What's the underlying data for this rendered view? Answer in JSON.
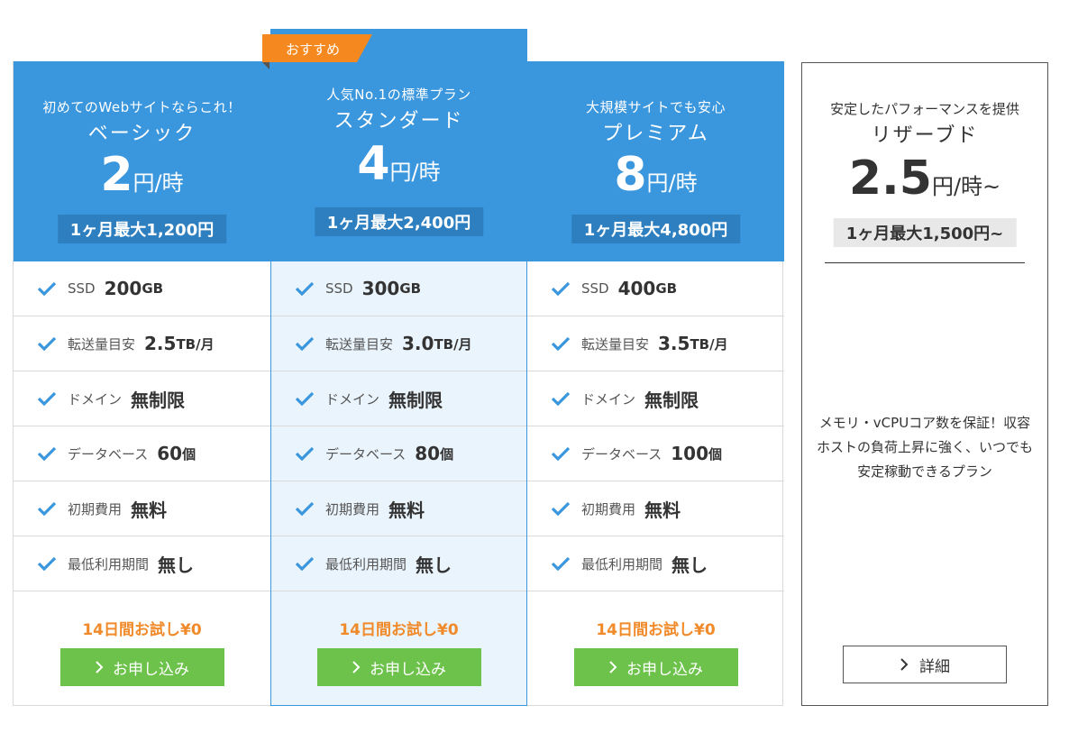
{
  "badge": {
    "label": "おすすめ"
  },
  "colors": {
    "brand_blue": "#3a96dd",
    "monthly_bg": "#2d7fc0",
    "recommended_bg": "#eaf4fc",
    "badge_orange": "#f5891f",
    "trial_orange": "#f08a2a",
    "button_green": "#6cc24a",
    "check_blue": "#3a96dd"
  },
  "plans": [
    {
      "tagline": "初めてのWebサイトならこれ！",
      "name": "ベーシック",
      "price": "2",
      "price_unit": "円/時",
      "monthly": "1ヶ月最大1,200円",
      "features": [
        {
          "label": "SSD",
          "value": "200",
          "unit": "GB"
        },
        {
          "label": "転送量目安",
          "value": "2.5",
          "unit": "TB/月"
        },
        {
          "label": "ドメイン",
          "value": "無制限",
          "unit": ""
        },
        {
          "label": "データベース",
          "value": "60",
          "unit": "個"
        },
        {
          "label": "初期費用",
          "value": "無料",
          "unit": ""
        },
        {
          "label": "最低利用期間",
          "value": "無し",
          "unit": ""
        }
      ],
      "trial": "14日間お試し¥0",
      "button": "お申し込み"
    },
    {
      "tagline": "人気No.1の標準プラン",
      "name": "スタンダード",
      "price": "4",
      "price_unit": "円/時",
      "monthly": "1ヶ月最大2,400円",
      "features": [
        {
          "label": "SSD",
          "value": "300",
          "unit": "GB"
        },
        {
          "label": "転送量目安",
          "value": "3.0",
          "unit": "TB/月"
        },
        {
          "label": "ドメイン",
          "value": "無制限",
          "unit": ""
        },
        {
          "label": "データベース",
          "value": "80",
          "unit": "個"
        },
        {
          "label": "初期費用",
          "value": "無料",
          "unit": ""
        },
        {
          "label": "最低利用期間",
          "value": "無し",
          "unit": ""
        }
      ],
      "trial": "14日間お試し¥0",
      "button": "お申し込み"
    },
    {
      "tagline": "大規模サイトでも安心",
      "name": "プレミアム",
      "price": "8",
      "price_unit": "円/時",
      "monthly": "1ヶ月最大4,800円",
      "features": [
        {
          "label": "SSD",
          "value": "400",
          "unit": "GB"
        },
        {
          "label": "転送量目安",
          "value": "3.5",
          "unit": "TB/月"
        },
        {
          "label": "ドメイン",
          "value": "無制限",
          "unit": ""
        },
        {
          "label": "データベース",
          "value": "100",
          "unit": "個"
        },
        {
          "label": "初期費用",
          "value": "無料",
          "unit": ""
        },
        {
          "label": "最低利用期間",
          "value": "無し",
          "unit": ""
        }
      ],
      "trial": "14日間お試し¥0",
      "button": "お申し込み"
    }
  ],
  "reserved": {
    "tagline": "安定したパフォーマンスを提供",
    "name": "リザーブド",
    "price": "2.5",
    "price_unit": "円/時~",
    "monthly": "1ヶ月最大1,500円~",
    "description": "メモリ・vCPUコア数を保証！収容ホストの負荷上昇に強く、いつでも安定稼動できるプラン",
    "button": "詳細"
  },
  "icons": {
    "feature": "check-icon",
    "button": "chevron-right-icon"
  }
}
